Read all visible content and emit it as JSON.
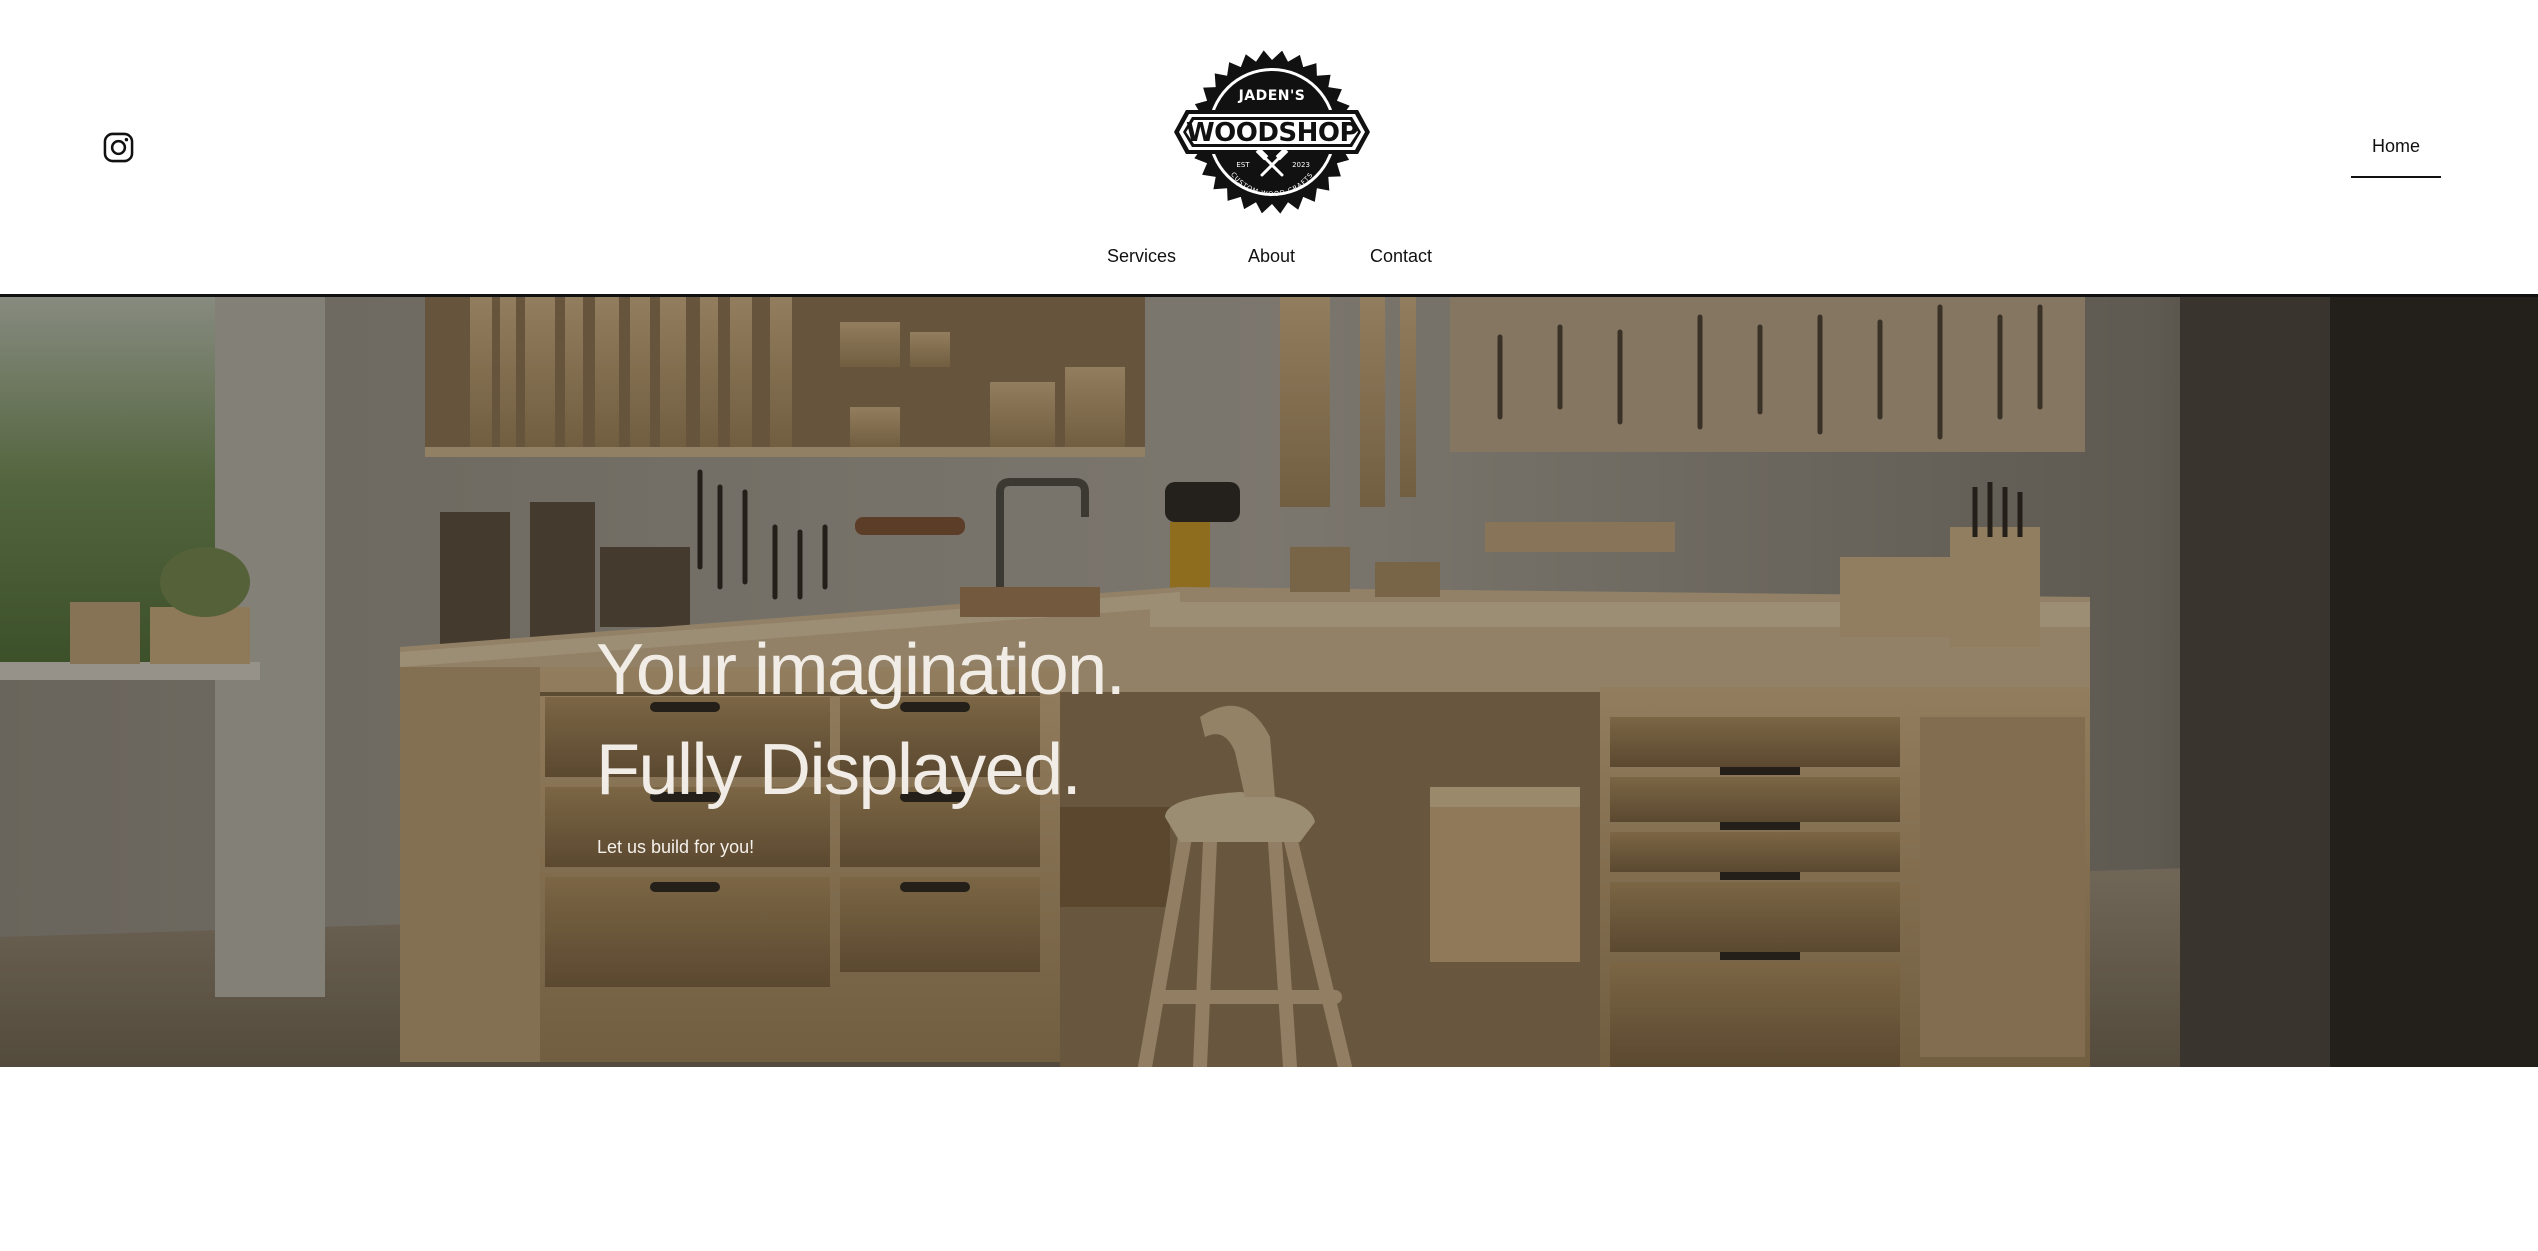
{
  "header": {
    "logo": {
      "top_text": "JADEN'S",
      "main_text": "WOODSHOP",
      "bottom_text": "CUSTOM WOOD CRAFTS",
      "est_left": "EST",
      "est_right": "2023",
      "icon": "saw-blade-logo"
    },
    "social": {
      "icon": "instagram-icon"
    },
    "nav": {
      "home": "Home",
      "services": "Services",
      "about": "About",
      "contact": "Contact"
    }
  },
  "hero": {
    "headline_line1": "Your imagination.",
    "headline_line2": "Fully Displayed.",
    "tagline": "Let us build for you!",
    "background": "woodshop-workbench-photo"
  },
  "colors": {
    "text": "#111111",
    "background": "#ffffff",
    "hero_text": "#f1ede6",
    "wood": "#c9a977"
  }
}
